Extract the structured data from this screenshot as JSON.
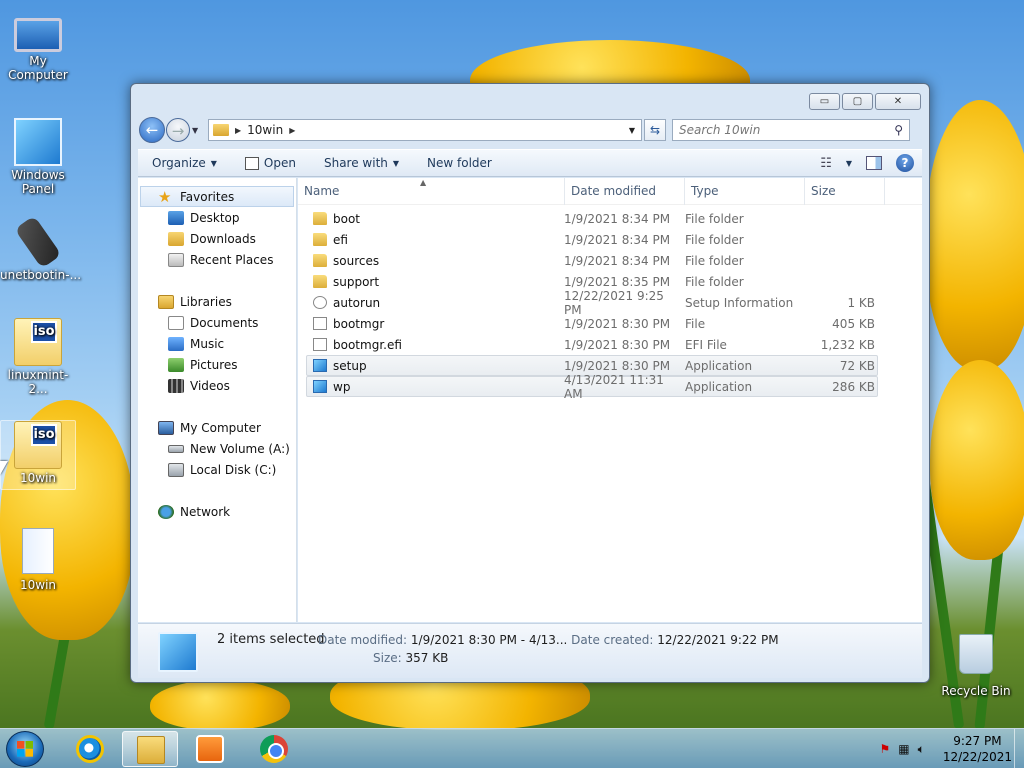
{
  "desktop": {
    "icons": [
      {
        "label": "My Computer",
        "icon": "computer-icon"
      },
      {
        "label": "Windows Panel",
        "icon": "windows-panel-icon"
      },
      {
        "label": "unetbootin-...",
        "icon": "usb-drive-icon"
      },
      {
        "label": "linuxmint-2...",
        "icon": "iso-file-icon"
      },
      {
        "label": "10win",
        "icon": "iso-file-icon"
      },
      {
        "label": "10win",
        "icon": "book-folder-icon"
      },
      {
        "label": "Recycle Bin",
        "icon": "recycle-bin-icon"
      }
    ],
    "iso_tag": "iso"
  },
  "window": {
    "controls": {
      "minimize": "▭",
      "maximize": "▢",
      "close": "✕"
    },
    "address": {
      "back": "←",
      "forward": "→",
      "path": "10win"
    },
    "search": {
      "placeholder": "Search 10win"
    },
    "toolbar": {
      "organize": "Organize",
      "open": "Open",
      "share_with": "Share with",
      "new_folder": "New folder",
      "help": "?"
    },
    "nav": {
      "favorites": "Favorites",
      "favorites_items": [
        "Desktop",
        "Downloads",
        "Recent Places"
      ],
      "libraries": "Libraries",
      "libraries_items": [
        "Documents",
        "Music",
        "Pictures",
        "Videos"
      ],
      "computer": "My Computer",
      "computer_items": [
        "New Volume (A:)",
        "Local Disk (C:)"
      ],
      "network": "Network"
    },
    "columns": {
      "name": "Name",
      "date": "Date modified",
      "type": "Type",
      "size": "Size"
    },
    "files": [
      {
        "name": "boot",
        "date": "1/9/2021 8:34 PM",
        "type": "File folder",
        "size": "",
        "icon": "folder-icon",
        "selected": false
      },
      {
        "name": "efi",
        "date": "1/9/2021 8:34 PM",
        "type": "File folder",
        "size": "",
        "icon": "folder-icon",
        "selected": false
      },
      {
        "name": "sources",
        "date": "1/9/2021 8:34 PM",
        "type": "File folder",
        "size": "",
        "icon": "folder-icon",
        "selected": false
      },
      {
        "name": "support",
        "date": "1/9/2021 8:35 PM",
        "type": "File folder",
        "size": "",
        "icon": "folder-icon",
        "selected": false
      },
      {
        "name": "autorun",
        "date": "12/22/2021 9:25 PM",
        "type": "Setup Information",
        "size": "1 KB",
        "icon": "setup-information-icon",
        "selected": false
      },
      {
        "name": "bootmgr",
        "date": "1/9/2021 8:30 PM",
        "type": "File",
        "size": "405 KB",
        "icon": "file-icon",
        "selected": false
      },
      {
        "name": "bootmgr.efi",
        "date": "1/9/2021 8:30 PM",
        "type": "EFI File",
        "size": "1,232 KB",
        "icon": "file-icon",
        "selected": false
      },
      {
        "name": "setup",
        "date": "1/9/2021 8:30 PM",
        "type": "Application",
        "size": "72 KB",
        "icon": "application-icon",
        "selected": true
      },
      {
        "name": "wp",
        "date": "4/13/2021 11:31 AM",
        "type": "Application",
        "size": "286 KB",
        "icon": "application-icon",
        "selected": true
      }
    ],
    "details": {
      "selected": "2 items selected",
      "date_modified_label": "Date modified:",
      "date_modified": "1/9/2021 8:30 PM - 4/13...",
      "date_created_label": "Date created:",
      "date_created": "12/22/2021 9:22 PM",
      "size_label": "Size:",
      "size": "357 KB"
    }
  },
  "taskbar": {
    "apps": [
      "internet-explorer",
      "windows-explorer",
      "media-player",
      "chrome"
    ],
    "clock_time": "9:27 PM",
    "clock_date": "12/22/2021"
  }
}
